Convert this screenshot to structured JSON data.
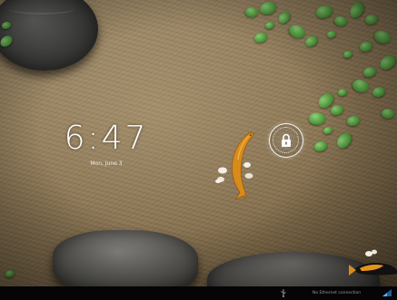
{
  "lockscreen": {
    "time": "6:47",
    "date": "Mon, June 3"
  },
  "status_bar": {
    "notification_text": "No Ethernet connection",
    "left_icon": "usb-icon",
    "right_icon": "ethernet-signal-icon"
  },
  "unlock": {
    "icon": "lock-icon"
  },
  "wallpaper": {
    "name": "zen-garden-koi",
    "colors": {
      "sand": "#8a7452",
      "stone": "#5f5e5a",
      "leaf": "#4e9a3a",
      "koi": "#d88a1a"
    }
  }
}
